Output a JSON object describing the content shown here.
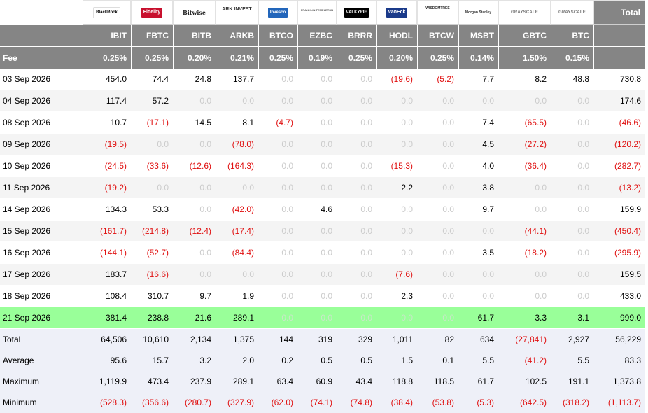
{
  "table": {
    "total_label": "Total",
    "logos": [
      {
        "name": "blackrock-logo",
        "text": "BlackRock",
        "cls": "lg-blk"
      },
      {
        "name": "fidelity-logo",
        "text": "Fidelity",
        "cls": "lg-red"
      },
      {
        "name": "bitwise-logo",
        "text": "Bitwise",
        "cls": "lg-serif"
      },
      {
        "name": "ark-logo",
        "text": "ARK INVEST",
        "cls": "lg-ark"
      },
      {
        "name": "invesco-logo",
        "text": "Invesco",
        "cls": "lg-inv"
      },
      {
        "name": "franklin-logo",
        "text": "FRANKLIN TEMPLETON",
        "cls": "lg-fr"
      },
      {
        "name": "valkyrie-logo",
        "text": "VALKYRIE",
        "cls": "lg-val"
      },
      {
        "name": "vaneck-logo",
        "text": "VanEck",
        "cls": "lg-van"
      },
      {
        "name": "wisdomtree-logo",
        "text": "WISDOMTREE",
        "cls": "lg-wt"
      },
      {
        "name": "morgan-stanley-logo",
        "text": "Morgan Stanley",
        "cls": "lg-ms"
      },
      {
        "name": "grayscale-logo",
        "text": "GRAYSCALE",
        "cls": "lg-gs"
      },
      {
        "name": "grayscale-mini-logo",
        "text": "GRAYSCALE",
        "cls": "lg-gs"
      }
    ],
    "tickers": [
      "IBIT",
      "FBTC",
      "BITB",
      "ARKB",
      "BTCO",
      "EZBC",
      "BRRR",
      "HODL",
      "BTCW",
      "MSBT",
      "GBTC",
      "BTC"
    ],
    "fee_label": "Fee",
    "fees": [
      "0.25%",
      "0.25%",
      "0.20%",
      "0.21%",
      "0.25%",
      "0.19%",
      "0.25%",
      "0.20%",
      "0.25%",
      "0.14%",
      "1.50%",
      "0.15%"
    ],
    "rows": [
      {
        "date": "03 Sep 2026",
        "values": [
          "454.0",
          "74.4",
          "24.8",
          "137.7",
          "0.0",
          "0.0",
          "0.0",
          "(19.6)",
          "(5.2)",
          "7.7",
          "8.2",
          "48.8"
        ],
        "total": "730.8"
      },
      {
        "date": "04 Sep 2026",
        "values": [
          "117.4",
          "57.2",
          "0.0",
          "0.0",
          "0.0",
          "0.0",
          "0.0",
          "0.0",
          "0.0",
          "0.0",
          "0.0",
          "0.0"
        ],
        "total": "174.6"
      },
      {
        "date": "08 Sep 2026",
        "values": [
          "10.7",
          "(17.1)",
          "14.5",
          "8.1",
          "(4.7)",
          "0.0",
          "0.0",
          "0.0",
          "0.0",
          "7.4",
          "(65.5)",
          "0.0"
        ],
        "total": "(46.6)"
      },
      {
        "date": "09 Sep 2026",
        "values": [
          "(19.5)",
          "0.0",
          "0.0",
          "(78.0)",
          "0.0",
          "0.0",
          "0.0",
          "0.0",
          "0.0",
          "4.5",
          "(27.2)",
          "0.0"
        ],
        "total": "(120.2)"
      },
      {
        "date": "10 Sep 2026",
        "values": [
          "(24.5)",
          "(33.6)",
          "(12.6)",
          "(164.3)",
          "0.0",
          "0.0",
          "0.0",
          "(15.3)",
          "0.0",
          "4.0",
          "(36.4)",
          "0.0"
        ],
        "total": "(282.7)"
      },
      {
        "date": "11 Sep 2026",
        "values": [
          "(19.2)",
          "0.0",
          "0.0",
          "0.0",
          "0.0",
          "0.0",
          "0.0",
          "2.2",
          "0.0",
          "3.8",
          "0.0",
          "0.0"
        ],
        "total": "(13.2)"
      },
      {
        "date": "14 Sep 2026",
        "values": [
          "134.3",
          "53.3",
          "0.0",
          "(42.0)",
          "0.0",
          "4.6",
          "0.0",
          "0.0",
          "0.0",
          "9.7",
          "0.0",
          "0.0"
        ],
        "total": "159.9"
      },
      {
        "date": "15 Sep 2026",
        "values": [
          "(161.7)",
          "(214.8)",
          "(12.4)",
          "(17.4)",
          "0.0",
          "0.0",
          "0.0",
          "0.0",
          "0.0",
          "0.0",
          "(44.1)",
          "0.0"
        ],
        "total": "(450.4)"
      },
      {
        "date": "16 Sep 2026",
        "values": [
          "(144.1)",
          "(52.7)",
          "0.0",
          "(84.4)",
          "0.0",
          "0.0",
          "0.0",
          "0.0",
          "0.0",
          "3.5",
          "(18.2)",
          "0.0"
        ],
        "total": "(295.9)"
      },
      {
        "date": "17 Sep 2026",
        "values": [
          "183.7",
          "(16.6)",
          "0.0",
          "0.0",
          "0.0",
          "0.0",
          "0.0",
          "(7.6)",
          "0.0",
          "0.0",
          "0.0",
          "0.0"
        ],
        "total": "159.5"
      },
      {
        "date": "18 Sep 2026",
        "values": [
          "108.4",
          "310.7",
          "9.7",
          "1.9",
          "0.0",
          "0.0",
          "0.0",
          "2.3",
          "0.0",
          "0.0",
          "0.0",
          "0.0"
        ],
        "total": "433.0"
      },
      {
        "date": "21 Sep 2026",
        "values": [
          "381.4",
          "238.8",
          "21.6",
          "289.1",
          "0.0",
          "0.0",
          "0.0",
          "0.0",
          "0.0",
          "61.7",
          "3.3",
          "3.1"
        ],
        "total": "999.0",
        "highlight": true
      }
    ],
    "summary": [
      {
        "label": "Total",
        "values": [
          "64,506",
          "10,610",
          "2,134",
          "1,375",
          "144",
          "319",
          "329",
          "1,011",
          "82",
          "634",
          "(27,841)",
          "2,927"
        ],
        "total": "56,229"
      },
      {
        "label": "Average",
        "values": [
          "95.6",
          "15.7",
          "3.2",
          "2.0",
          "0.2",
          "0.5",
          "0.5",
          "1.5",
          "0.1",
          "5.5",
          "(41.2)",
          "5.5"
        ],
        "total": "83.3"
      },
      {
        "label": "Maximum",
        "values": [
          "1,119.9",
          "473.4",
          "237.9",
          "289.1",
          "63.4",
          "60.9",
          "43.4",
          "118.8",
          "118.5",
          "61.7",
          "102.5",
          "191.1"
        ],
        "total": "1,373.8"
      },
      {
        "label": "Minimum",
        "values": [
          "(528.3)",
          "(356.6)",
          "(280.7)",
          "(327.9)",
          "(62.0)",
          "(74.1)",
          "(74.8)",
          "(38.4)",
          "(53.8)",
          "(5.3)",
          "(642.5)",
          "(318.2)"
        ],
        "total": "(1,113.7)"
      }
    ]
  }
}
